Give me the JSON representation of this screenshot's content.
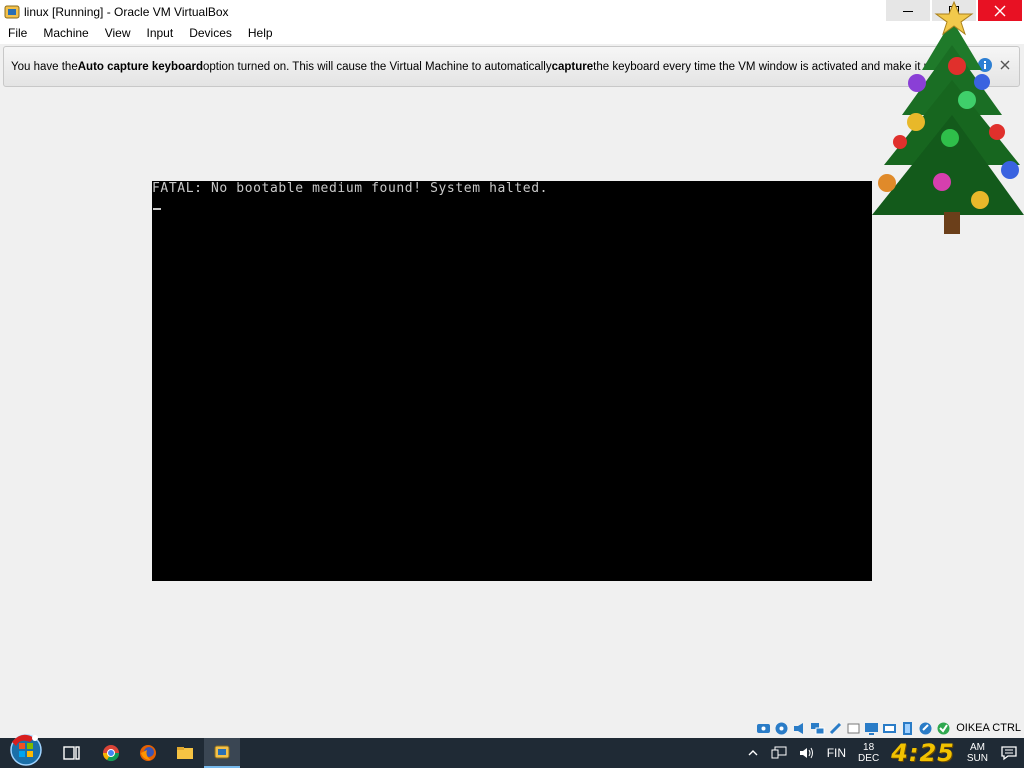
{
  "window": {
    "title": "linux [Running] - Oracle VM VirtualBox"
  },
  "menu": [
    "File",
    "Machine",
    "View",
    "Input",
    "Devices",
    "Help"
  ],
  "notice": {
    "part1": "You have the ",
    "bold1": "Auto capture keyboard",
    "part2": " option turned on. This will cause the Virtual Machine to automatically ",
    "bold2": "capture",
    "part3": " the keyboard every time the VM window is activated and make it u"
  },
  "vm": {
    "message": "FATAL: No bootable medium found! System halted."
  },
  "status": {
    "icons": [
      "hard-disk-icon",
      "optical-disk-icon",
      "audio-icon",
      "network-icon",
      "usb-icon",
      "shared-folders-icon",
      "display-icon",
      "video-capture-icon",
      "virtualization-icon",
      "mouse-integration-icon",
      "keyboard-capture-icon"
    ],
    "host_key": "OIKEA CTRL"
  },
  "taskbar": {
    "apps": [
      "task-view",
      "chrome",
      "firefox",
      "file-explorer",
      "virtualbox"
    ],
    "language": "FIN",
    "date_day": "18",
    "date_month": "DEC",
    "time": "4:25",
    "ampm": "AM",
    "weekday": "SUN"
  },
  "colors": {
    "close_button": "#e81123",
    "taskbar": "#1f2a35",
    "clock": "#f2c200",
    "vm_background": "#000000"
  }
}
